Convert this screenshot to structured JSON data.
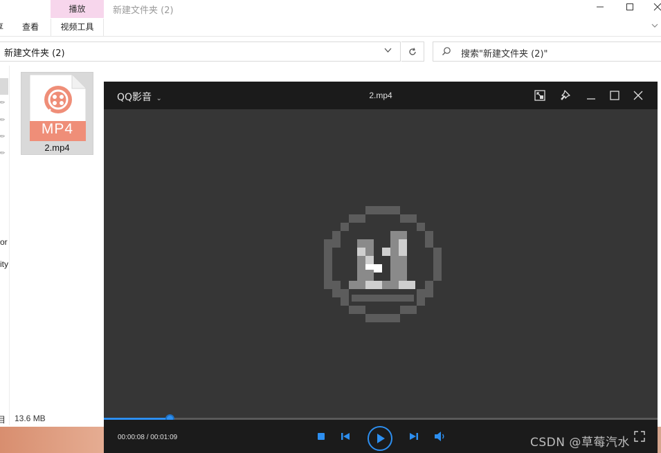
{
  "explorer": {
    "window_title": "新建文件夹 (2)",
    "ribbon": {
      "context_group": "播放",
      "tabs": [
        "享",
        "查看",
        "视频工具"
      ]
    },
    "address": "新建文件夹 (2)",
    "search_placeholder": "搜索\"新建文件夹 (2)\"",
    "nav_fragments": [
      "or",
      "ity"
    ],
    "file": {
      "name": "2.mp4",
      "badge": "MP4"
    },
    "status": {
      "items_fragment": "目",
      "size": "13.6 MB"
    }
  },
  "player": {
    "brand": "QQ影音",
    "file_name": "2.mp4",
    "time": "00:00:08 / 00:01:09",
    "progress": 0.12,
    "accent": "#2d8ff0",
    "title_icons": [
      "mini-mode-icon",
      "pin-icon",
      "minimize-icon",
      "maximize-icon",
      "close-icon"
    ],
    "control_icons": [
      "stop-icon",
      "previous-icon",
      "play-icon",
      "next-icon",
      "volume-icon",
      "fullscreen-icon"
    ]
  },
  "watermark": "CSDN @草莓汽水"
}
